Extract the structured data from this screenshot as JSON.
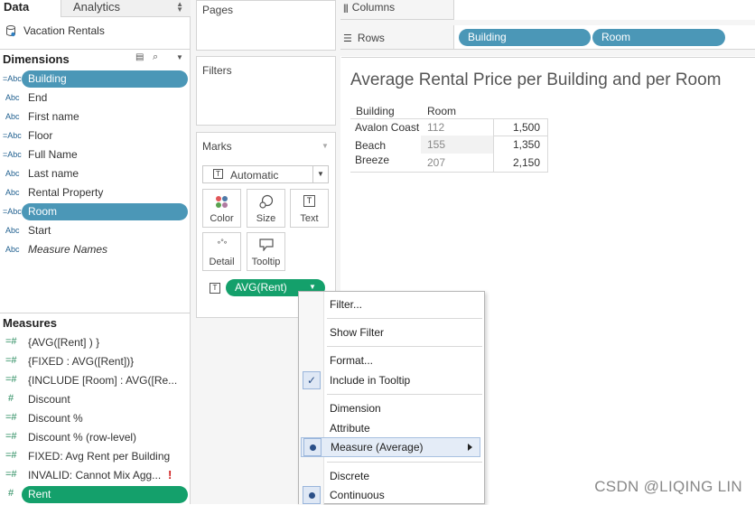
{
  "tabs": {
    "data": "Data",
    "analytics": "Analytics"
  },
  "datasource": {
    "name": "Vacation Rentals"
  },
  "dimensions": {
    "header": "Dimensions",
    "items": [
      {
        "icon": "=Abc",
        "label": "Building",
        "selected": true
      },
      {
        "icon": "Abc",
        "label": "End"
      },
      {
        "icon": "Abc",
        "label": "First name"
      },
      {
        "icon": "=Abc",
        "label": "Floor"
      },
      {
        "icon": "=Abc",
        "label": "Full Name"
      },
      {
        "icon": "Abc",
        "label": "Last name"
      },
      {
        "icon": "Abc",
        "label": "Rental Property"
      },
      {
        "icon": "=Abc",
        "label": "Room",
        "selected": true
      },
      {
        "icon": "Abc",
        "label": "Start"
      },
      {
        "icon": "Abc",
        "label": "Measure Names"
      }
    ]
  },
  "measures": {
    "header": "Measures",
    "items": [
      {
        "icon": "=#",
        "label": "{AVG([Rent] ) }"
      },
      {
        "icon": "=#",
        "label": "{FIXED : AVG([Rent])}"
      },
      {
        "icon": "=#",
        "label": "{INCLUDE [Room] : AVG([Re..."
      },
      {
        "icon": "#",
        "label": "Discount"
      },
      {
        "icon": "=#",
        "label": "Discount %"
      },
      {
        "icon": "=#",
        "label": "Discount % (row-level)"
      },
      {
        "icon": "=#",
        "label": "FIXED: Avg Rent per Building"
      },
      {
        "icon": "=#",
        "label": "INVALID: Cannot Mix Agg..."
      },
      {
        "icon": "#",
        "label": "Rent"
      }
    ]
  },
  "cards": {
    "pages": "Pages",
    "filters": "Filters",
    "marks": "Marks",
    "mark_type": "Automatic",
    "buttons": [
      "Color",
      "Size",
      "Text",
      "Detail",
      "Tooltip"
    ],
    "text_pill": "AVG(Rent)"
  },
  "shelves": {
    "columns": "Columns",
    "rows": "Rows",
    "row_pills": [
      "Building",
      "Room"
    ]
  },
  "view": {
    "title": "Average Rental Price per Building and per Room",
    "headers": [
      "Building",
      "Room"
    ],
    "rows": [
      {
        "building": "Avalon Coast",
        "room": "112",
        "value": "1,500"
      },
      {
        "building": "Beach Breeze",
        "room": "155",
        "value": "1,350"
      },
      {
        "building": "",
        "room": "207",
        "value": "2,150"
      }
    ]
  },
  "menu": {
    "items": [
      "Filter...",
      "Show Filter",
      "Format...",
      "Include in Tooltip",
      "Dimension",
      "Attribute",
      "Measure (Average)",
      "Discrete",
      "Continuous"
    ]
  },
  "watermark": "CSDN @LIQING LIN"
}
